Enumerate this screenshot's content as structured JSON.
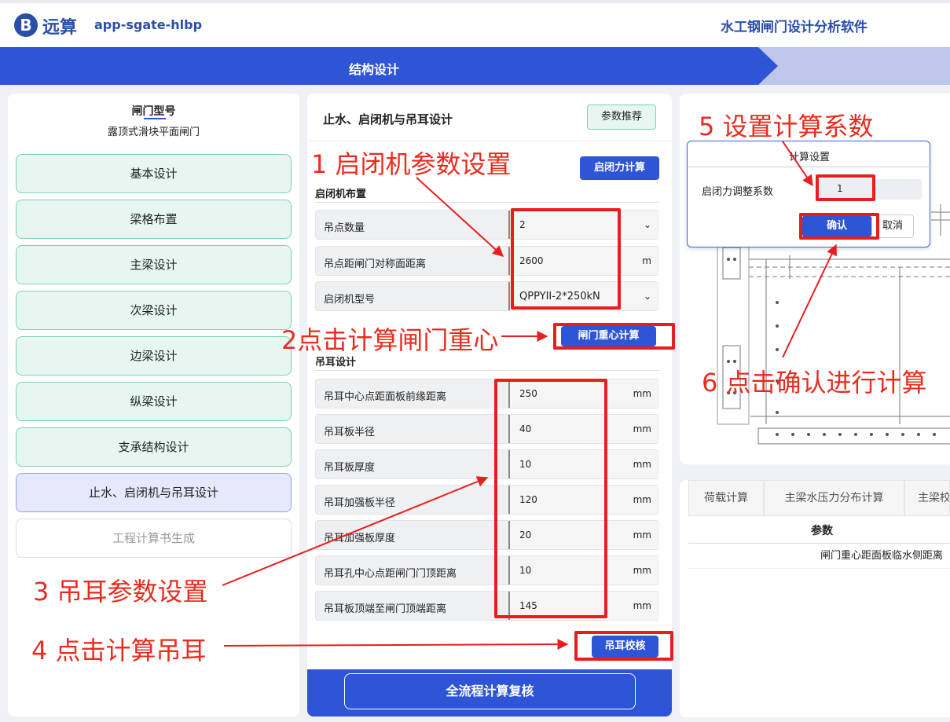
{
  "header": {
    "logo_letter": "B",
    "logo_text": "远算",
    "app_id": "app-sgate-hlbp",
    "app_title": "水工钢闸门设计分析软件"
  },
  "stepbar": {
    "active_step": "结构设计"
  },
  "left_panel": {
    "gate_type_label": "闸门型号",
    "gate_type_value": "露顶式滑块平面闸门",
    "nav_items": [
      {
        "label": "基本设计",
        "state": "normal"
      },
      {
        "label": "梁格布置",
        "state": "normal"
      },
      {
        "label": "主梁设计",
        "state": "normal"
      },
      {
        "label": "次梁设计",
        "state": "normal"
      },
      {
        "label": "边梁设计",
        "state": "normal"
      },
      {
        "label": "纵梁设计",
        "state": "normal"
      },
      {
        "label": "支承结构设计",
        "state": "normal"
      },
      {
        "label": "止水、启闭机与吊耳设计",
        "state": "active"
      },
      {
        "label": "工程计算书生成",
        "state": "disabled"
      }
    ]
  },
  "mid_panel": {
    "title": "止水、启闭机与吊耳设计",
    "recommend_button": "参数推荐",
    "force_calc_button": "启闭力计算",
    "hoist_section": "启闭机布置",
    "hoist_rows": [
      {
        "label": "吊点数量",
        "value": "2",
        "unit": "",
        "dropdown": true
      },
      {
        "label": "吊点距闸门对称面距离",
        "value": "2600",
        "unit": "m",
        "dropdown": false
      },
      {
        "label": "启闭机型号",
        "value": "QPPYII-2*250kN",
        "unit": "",
        "dropdown": true
      }
    ],
    "cg_button": "闸门重心计算",
    "ear_section": "吊耳设计",
    "ear_rows": [
      {
        "label": "吊耳中心点距面板前缘距离",
        "value": "250",
        "unit": "mm"
      },
      {
        "label": "吊耳板半径",
        "value": "40",
        "unit": "mm"
      },
      {
        "label": "吊耳板厚度",
        "value": "10",
        "unit": "mm"
      },
      {
        "label": "吊耳加强板半径",
        "value": "120",
        "unit": "mm"
      },
      {
        "label": "吊耳加强板厚度",
        "value": "20",
        "unit": "mm"
      },
      {
        "label": "吊耳孔中心点距闸门门顶距离",
        "value": "10",
        "unit": "mm"
      },
      {
        "label": "吊耳板顶端至闸门顶端距离",
        "value": "145",
        "unit": "mm"
      }
    ],
    "ear_check_button": "吊耳校核",
    "full_check_button": "全流程计算复核"
  },
  "dialog": {
    "title": "计算设置",
    "field_label": "启闭力调整系数",
    "field_value": "1",
    "ok_button": "确认",
    "cancel_button": "取消"
  },
  "result_panel": {
    "tabs": [
      "荷载计算",
      "主梁水压力分布计算",
      "主梁校"
    ],
    "table_header": "参数",
    "table_row": "闸门重心距面板临水侧距离"
  },
  "annotations": {
    "a1": "1 启闭机参数设置",
    "a2": "2点击计算闸门重心",
    "a3": "3 吊耳参数设置",
    "a4": "4 点击计算吊耳",
    "a5": "5 设置计算系数",
    "a6": "6 点击确认进行计算"
  },
  "colors": {
    "primary": "#2e55d6",
    "annotation": "#e82c1f",
    "nav_normal_bg": "#e6f7f2"
  }
}
